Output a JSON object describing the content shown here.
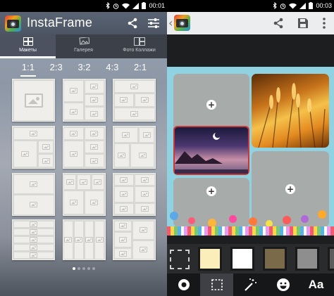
{
  "left": {
    "status": {
      "time": "00:01"
    },
    "app_title": "InstaFrame",
    "tabs": [
      {
        "label": "Макеты",
        "icon": "grid-icon",
        "active": true
      },
      {
        "label": "Галерея",
        "icon": "gallery-icon",
        "active": false
      },
      {
        "label": "Фото Коллажи",
        "icon": "collage-icon",
        "active": false
      }
    ],
    "ratios": [
      "1:1",
      "2:3",
      "3:2",
      "4:3",
      "2:1"
    ],
    "selected_ratio": "1:1",
    "page_dots": {
      "count": 5,
      "current": 1
    }
  },
  "right": {
    "status": {
      "time": "00:03"
    },
    "tools": [
      {
        "name": "border-tool",
        "icon": "circle-dot-icon"
      },
      {
        "name": "layout-tool",
        "icon": "dashed-square-icon",
        "active": true
      },
      {
        "name": "effects-tool",
        "icon": "magic-wand-icon"
      },
      {
        "name": "sticker-tool",
        "icon": "smiley-icon"
      },
      {
        "name": "text-tool",
        "icon": "text-aa-icon",
        "label": "Aa"
      }
    ],
    "swatches": [
      "none",
      "#fbeebb",
      "#ffffff",
      "#7a6a4a",
      "#8e8e8e",
      "#5c5c5c"
    ],
    "colors": {
      "canvas": "#8fd3e2",
      "slot": "#a7abaa"
    }
  }
}
